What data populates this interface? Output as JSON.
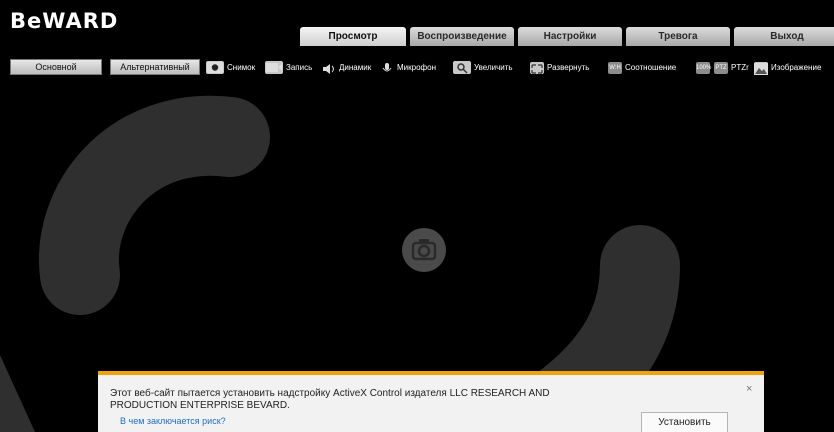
{
  "brand": {
    "logo_text": "BeWARD"
  },
  "tabs": [
    {
      "label": "Просмотр",
      "active": true
    },
    {
      "label": "Воспроизведение",
      "active": false
    },
    {
      "label": "Настройки",
      "active": false
    },
    {
      "label": "Тревога",
      "active": false
    },
    {
      "label": "Выход",
      "active": false
    }
  ],
  "toolbar": {
    "stream_main": "Основной",
    "stream_alt": "Альтернативный",
    "snapshot": "Снимок",
    "record": "Запись",
    "speaker": "Динамик",
    "microphone": "Микрофон",
    "zoom": "Увеличить",
    "fullscreen": "Развернуть",
    "ratio": "Соотношение",
    "ratio_icon": "W:H",
    "ratio_100": "100%",
    "ptz_icon": "PTZ",
    "ptz": "PTZr",
    "image": "Изображение"
  },
  "notice": {
    "line1": "Этот веб-сайт пытается установить надстройку ActiveX Control издателя LLC RESEARCH AND",
    "line2": "PRODUCTION ENTERPRISE BEVARD.",
    "link": "В чем заключается риск?",
    "install": "Установить",
    "close": "×"
  },
  "colors": {
    "accent": "#f0a30a",
    "link": "#1e6fc3",
    "background": "#000000"
  }
}
